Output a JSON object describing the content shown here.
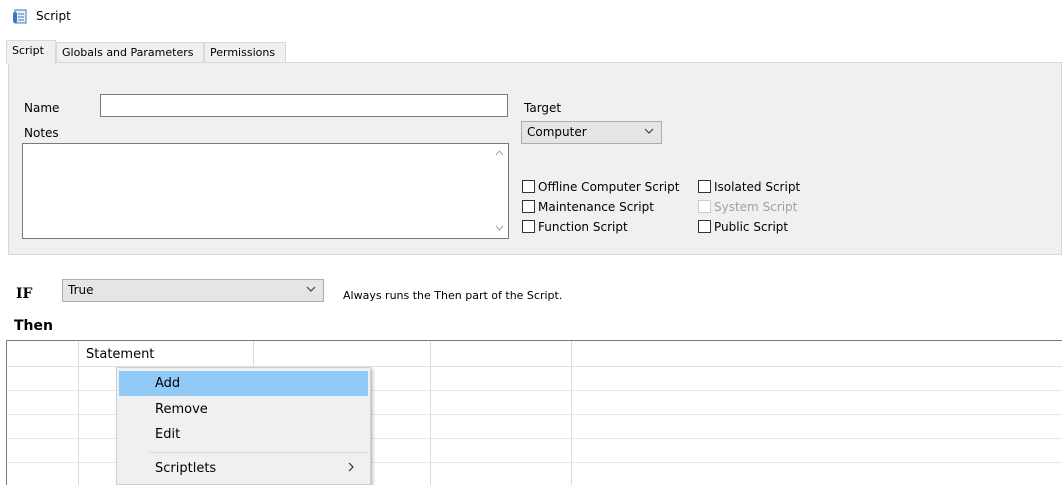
{
  "window": {
    "title": "Script",
    "icon": "script-icon"
  },
  "tabs": [
    {
      "label": "Script",
      "active": true
    },
    {
      "label": "Globals and Parameters",
      "active": false
    },
    {
      "label": "Permissions",
      "active": false
    }
  ],
  "form": {
    "name_label": "Name",
    "name_value": "",
    "notes_label": "Notes",
    "notes_value": "",
    "target_label": "Target",
    "target_value": "Computer"
  },
  "checkboxes": [
    {
      "label": "Offline Computer Script",
      "checked": false,
      "enabled": true
    },
    {
      "label": "Maintenance Script",
      "checked": false,
      "enabled": true
    },
    {
      "label": "Function Script",
      "checked": false,
      "enabled": true
    },
    {
      "label": "Isolated Script",
      "checked": false,
      "enabled": true
    },
    {
      "label": "System Script",
      "checked": false,
      "enabled": false
    },
    {
      "label": "Public Script",
      "checked": false,
      "enabled": true
    }
  ],
  "condition": {
    "if_label": "IF",
    "if_value": "True",
    "hint": "Always runs the Then part of the Script.",
    "then_label": "Then"
  },
  "grid": {
    "columns": [
      "",
      "Statement",
      "",
      ""
    ]
  },
  "context_menu": {
    "items": [
      {
        "label": "Add",
        "highlighted": true
      },
      {
        "label": "Remove",
        "highlighted": false
      },
      {
        "label": "Edit",
        "highlighted": false
      },
      {
        "label": "Scriptlets",
        "highlighted": false,
        "submenu": true
      }
    ]
  },
  "colors": {
    "panel": "#f0f0f0",
    "highlight": "#91c9f7",
    "border": "#7a7a7a"
  }
}
